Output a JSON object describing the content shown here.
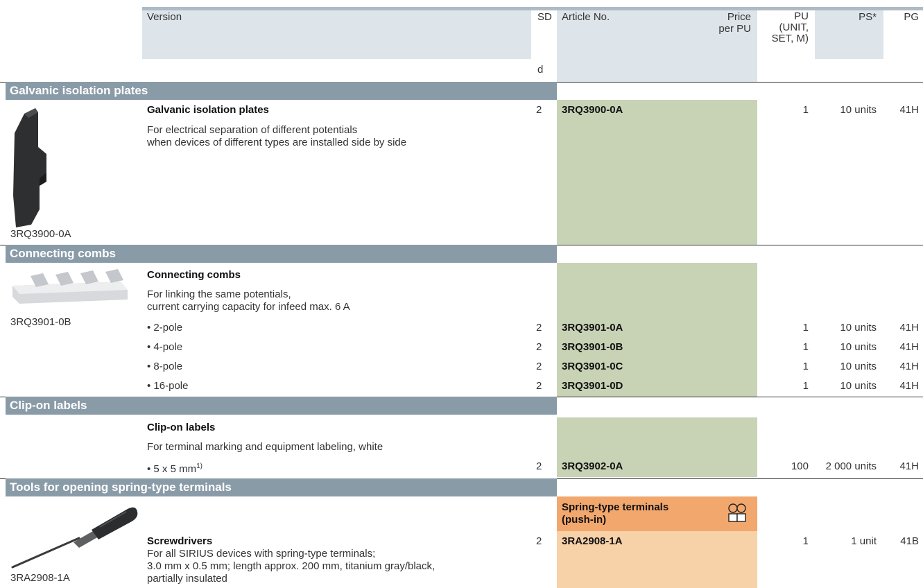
{
  "header": {
    "version": "Version",
    "sd": "SD",
    "sd_unit": "d",
    "article_no": "Article No.",
    "price": [
      "Price",
      "per PU"
    ],
    "pu": [
      "PU",
      "(UNIT,",
      "SET, M)"
    ],
    "ps": "PS*",
    "pg": "PG"
  },
  "sections": {
    "galvanic": {
      "band": "Galvanic isolation plates",
      "image_label": "3RQ3900-0A",
      "title": "Galvanic isolation plates",
      "desc1": "For electrical separation of different potentials",
      "desc2": "when devices of different types are installed side by side",
      "sd": "2",
      "article": "3RQ3900-0A",
      "pu": "1",
      "ps": "10 units",
      "pg": "41H"
    },
    "combs": {
      "band": "Connecting combs",
      "image_label": "3RQ3901-0B",
      "title": "Connecting combs",
      "desc1": "For linking the same potentials,",
      "desc2": "current carrying capacity for infeed max. 6 A",
      "rows": [
        {
          "label": "• 2-pole",
          "sd": "2",
          "article": "3RQ3901-0A",
          "pu": "1",
          "ps": "10 units",
          "pg": "41H"
        },
        {
          "label": "• 4-pole",
          "sd": "2",
          "article": "3RQ3901-0B",
          "pu": "1",
          "ps": "10 units",
          "pg": "41H"
        },
        {
          "label": "• 8-pole",
          "sd": "2",
          "article": "3RQ3901-0C",
          "pu": "1",
          "ps": "10 units",
          "pg": "41H"
        },
        {
          "label": "• 16-pole",
          "sd": "2",
          "article": "3RQ3901-0D",
          "pu": "1",
          "ps": "10 units",
          "pg": "41H"
        }
      ]
    },
    "labels": {
      "band": "Clip-on labels",
      "title": "Clip-on labels",
      "desc1": "For terminal marking and equipment labeling, white",
      "row_label": "• 5 x 5 mm",
      "row_sup": "1)",
      "sd": "2",
      "article": "3RQ3902-0A",
      "pu": "100",
      "ps": "2 000 units",
      "pg": "41H"
    },
    "tools": {
      "band": "Tools for opening spring-type terminals",
      "image_label": "3RA2908-1A",
      "terminal_head": [
        "Spring-type terminals",
        "(push-in)"
      ],
      "title": "Screwdrivers",
      "desc1": "For all SIRIUS devices with spring-type terminals;",
      "desc2": "3.0 mm x 0.5 mm; length approx. 200 mm, titanium gray/black,",
      "desc3": "partially insulated",
      "sd": "2",
      "article": "3RA2908-1A",
      "pu": "1",
      "ps": "1 unit",
      "pg": "41B"
    }
  },
  "colors": {
    "band": "#8a9ba8",
    "header_shade": "#dde4ea",
    "article_green": "#c8d3b6",
    "spring_orange_head": "#f2a76d",
    "spring_orange": "#f7d1a8"
  }
}
